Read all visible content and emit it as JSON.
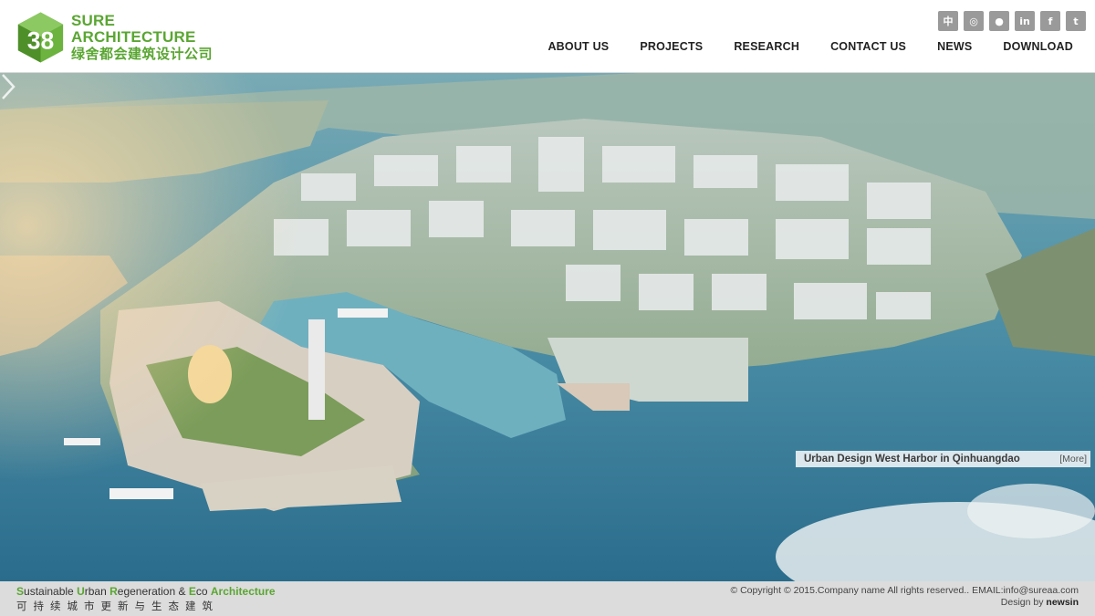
{
  "header": {
    "logo_en": "SURE ARCHITECTURE",
    "logo_cn": "绿舍都会建筑设计公司",
    "social": [
      {
        "icon": "chinese-language-icon",
        "glyph": "中"
      },
      {
        "icon": "weibo-icon",
        "glyph": "◎"
      },
      {
        "icon": "wechat-icon",
        "glyph": "●"
      },
      {
        "icon": "linkedin-icon",
        "glyph": "in"
      },
      {
        "icon": "facebook-icon",
        "glyph": "f"
      },
      {
        "icon": "twitter-icon",
        "glyph": "t"
      }
    ],
    "nav": [
      "ABOUT US",
      "PROJECTS",
      "RESEARCH",
      "CONTACT US",
      "NEWS",
      "DOWNLOAD"
    ]
  },
  "hero": {
    "caption_title": "Urban Design West Harbor in Qinhuangdao",
    "caption_more": "[More]"
  },
  "footer": {
    "slogan_words": [
      {
        "initial": "S",
        "rest": "ustainable "
      },
      {
        "initial": "U",
        "rest": "rban "
      },
      {
        "initial": "R",
        "rest": "egeneration & "
      },
      {
        "initial": "E",
        "rest": "co "
      },
      {
        "initial": "",
        "rest": "Architecture"
      }
    ],
    "slogan_cn": "可持续城市更新与生态建筑",
    "copyright": "© Copyright © 2015.Company name All rights reserved.. EMAIL:info@sureaa.com",
    "design_by_label": "Design by",
    "design_by_name": "newsin"
  },
  "colors": {
    "brand_green": "#5aa632",
    "footer_bg": "#dcdcdc",
    "nav_text": "#222222"
  }
}
